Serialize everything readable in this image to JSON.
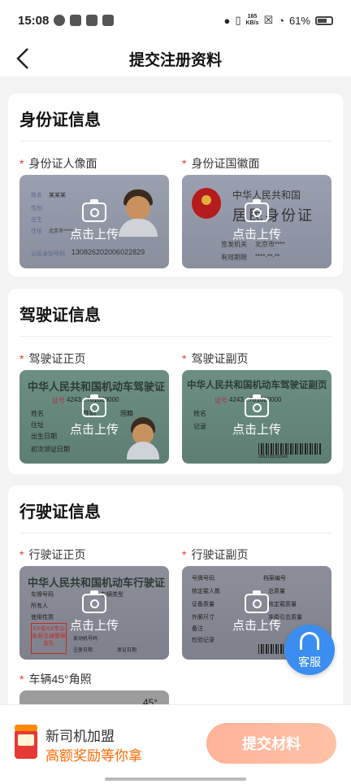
{
  "status_bar": {
    "time": "15:08",
    "net_speed": "165",
    "net_unit": "KB/s",
    "battery": "61%"
  },
  "header": {
    "title": "提交注册资料"
  },
  "upload_label": "点击上传",
  "id_section": {
    "title": "身份证信息",
    "front_label": "身份证人像面",
    "back_label": "身份证国徽面",
    "front_texts": {
      "name_label": "姓名",
      "name_value": "某某某",
      "gender_label": "性别",
      "birth_label": "出生",
      "addr_label": "住址",
      "addr_value": "北京市*****",
      "id_label": "公民身份号码",
      "id_value": "130826202006022829"
    },
    "back_texts": {
      "country": "中华人民共和国",
      "card_title": "居民身份证",
      "issuer_label": "签发机关",
      "issuer_value": "北京市****",
      "valid_label": "有效期限",
      "valid_value": "****-**-**"
    }
  },
  "driver_section": {
    "title": "驾驶证信息",
    "front_label": "驾驶证正页",
    "back_label": "驾驶证副页",
    "front_texts": {
      "title": "中华人民共和国机动车驾驶证",
      "cert_label": "证号",
      "cert_value": "4243...701020000",
      "name": "姓名",
      "gender": "性别",
      "country": "国籍",
      "addr": "住址",
      "birth": "出生日期",
      "first": "初次领证日期"
    },
    "back_texts": {
      "title": "中华人民共和国机动车驾驶证副页",
      "cert_label": "证号",
      "cert_value": "4243...701020000",
      "name": "姓名",
      "record": "记录",
      "barcode_num": "3052189162943"
    }
  },
  "vehicle_section": {
    "title": "行驶证信息",
    "front_label": "行驶证正页",
    "back_label": "行驶证副页",
    "extra_label": "车辆45°角照",
    "extra_badge": "45°",
    "front_texts": {
      "title": "中华人民共和国机动车行驶证",
      "plate": "车牌号码",
      "type": "车辆类型",
      "owner": "所有人",
      "usage": "使用性质",
      "engine": "发动机号码",
      "reg_date": "注册日期",
      "issue_date": "发证日期",
      "stamp": "XX省XX市公安局交通警察支队"
    },
    "back_texts": {
      "plate": "号牌号码",
      "file_no": "档案编号",
      "load": "核定载人数",
      "total": "总质量",
      "equip": "证备质量",
      "approved": "核定载质量",
      "dims": "外廓尺寸",
      "tow": "准牵引总质量",
      "note": "备注",
      "inspection": "检验记录"
    }
  },
  "service_button": {
    "label": "客服"
  },
  "bottom_bar": {
    "promo_line1": "新司机加盟",
    "promo_line2": "高额奖励等你拿",
    "submit_label": "提交材料"
  },
  "colors": {
    "required_star": "#e53935",
    "accent_orange": "#ff6a00",
    "service_blue": "#3b8ef0",
    "submit_gradient_start": "#ffb39a"
  }
}
